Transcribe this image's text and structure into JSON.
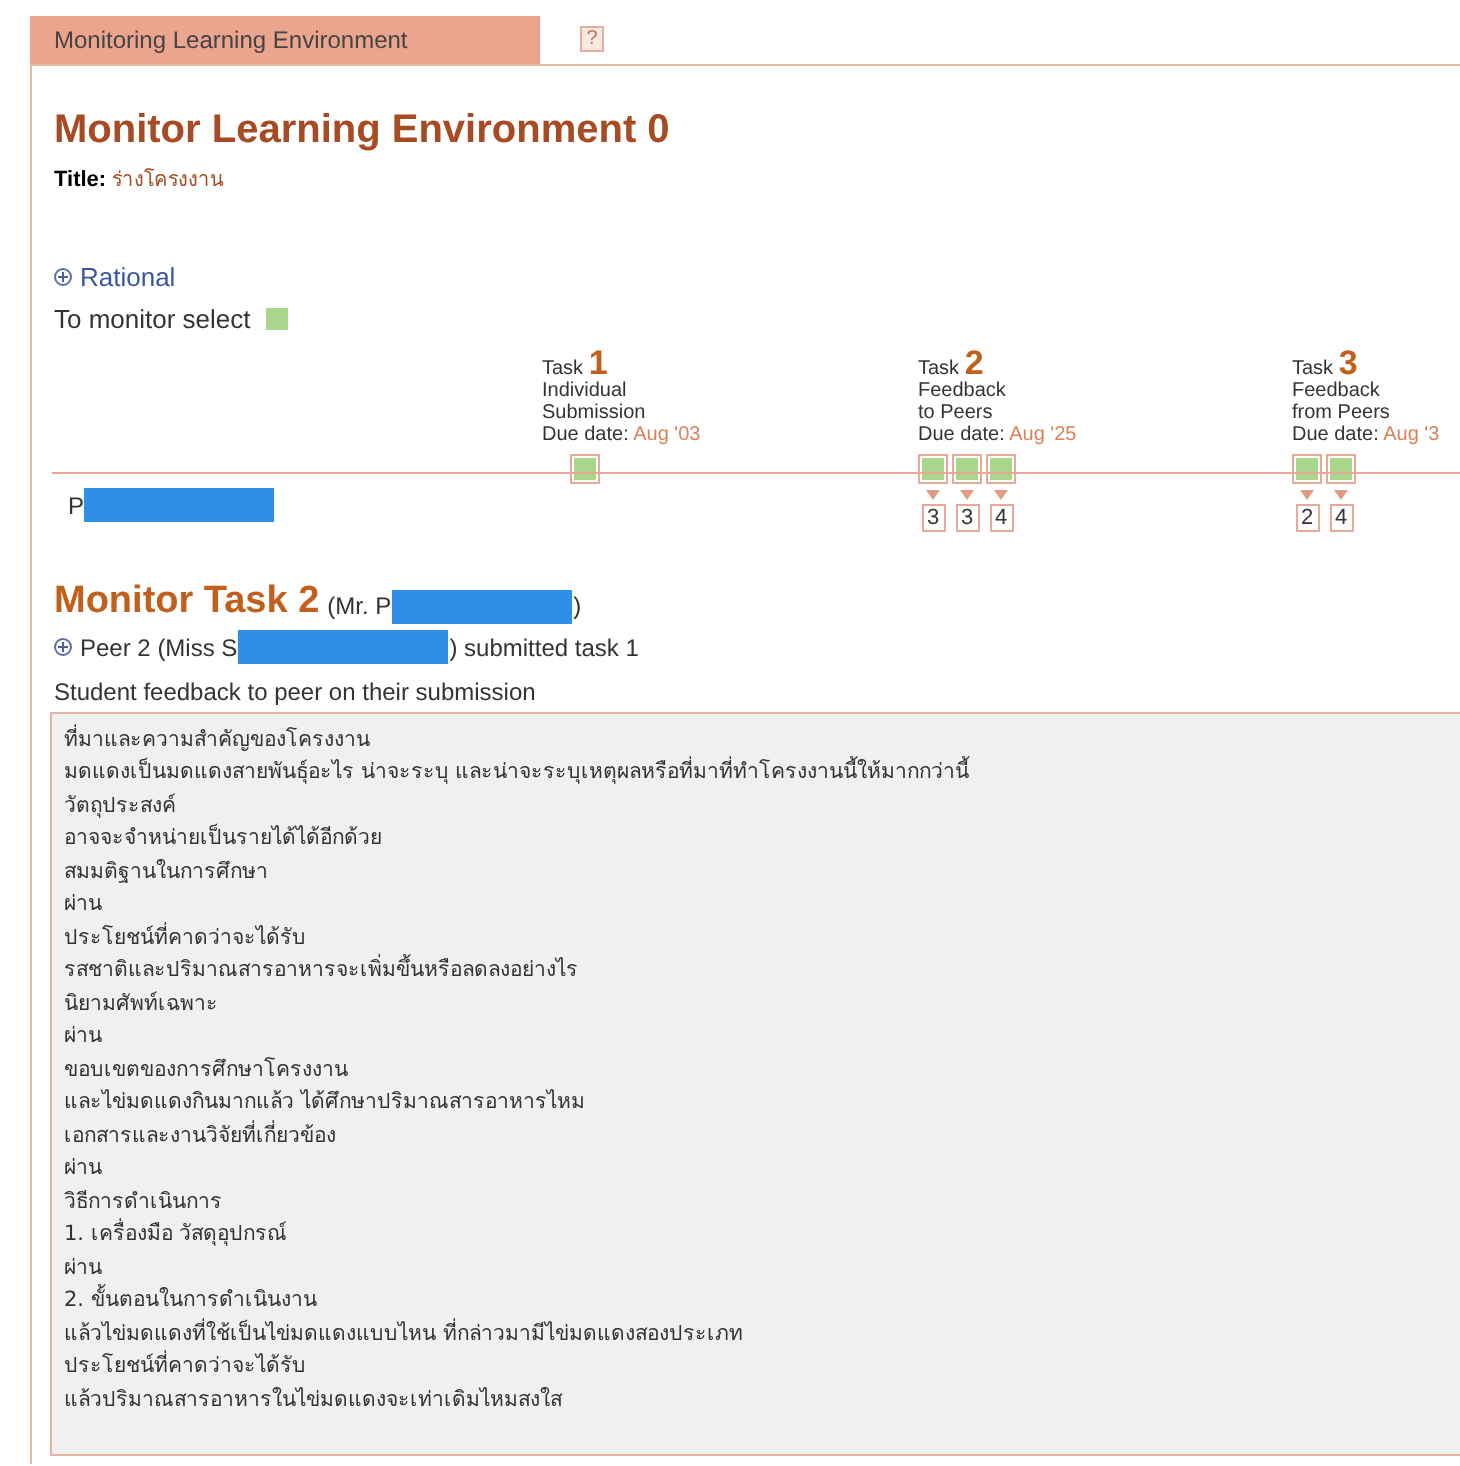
{
  "tab": {
    "label": "Monitoring Learning Environment",
    "selected": true
  },
  "help": {
    "label": "?"
  },
  "heading": "Monitor Learning Environment 0",
  "title": {
    "label": "Title:",
    "value": "ร่างโครงงาน"
  },
  "rational": {
    "label": "Rational",
    "expanded": false
  },
  "legend": {
    "label": "To monitor select"
  },
  "tasks": [
    {
      "word": "Task",
      "number": "1",
      "lines": [
        "Individual",
        "Submission"
      ],
      "due_label": "Due date:",
      "due": "Aug '03",
      "submissions": [
        {
          "kind": "pending"
        }
      ]
    },
    {
      "word": "Task",
      "number": "2",
      "lines": [
        "Feedback",
        "to Peers"
      ],
      "due_label": "Due date:",
      "due": "Aug '25",
      "submissions": [
        {
          "kind": "scored",
          "score": "3"
        },
        {
          "kind": "scored",
          "score": "3"
        },
        {
          "kind": "scored",
          "score": "4"
        }
      ]
    },
    {
      "word": "Task",
      "number": "3",
      "lines": [
        "Feedback",
        "from Peers"
      ],
      "due_label": "Due date:",
      "due": "Aug '3",
      "submissions": [
        {
          "kind": "scored",
          "score": "2"
        },
        {
          "kind": "scored",
          "score": "4"
        }
      ]
    }
  ],
  "student": {
    "name": "P",
    "redacted": true
  },
  "monitor": {
    "heading": "Monitor Task 2",
    "person_open": "(Mr. P",
    "person_close": ")",
    "redacted": true
  },
  "peer": {
    "expanded": false,
    "prefix": "Peer 2 (Miss S",
    "suffix": ") submitted task 1",
    "redacted": true
  },
  "feedback": {
    "label": "Student feedback to peer on their submission",
    "lines": [
      "ที่มาและความสำคัญของโครงงาน",
      "มดแดงเป็นมดแดงสายพันธุ์อะไร น่าจะระบุ และน่าจะระบุเหตุผลหรือที่มาที่ทำโครงงานนี้ให้มากกว่านี้",
      "วัตถุประสงค์",
      "อาจจะจำหน่ายเป็นรายได้ได้อีกด้วย",
      "สมมติฐานในการศึกษา",
      "ผ่าน",
      "ประโยชน์ที่คาดว่าจะได้รับ",
      "รสชาติและปริมาณสารอาหารจะเพิ่มขึ้นหรือลดลงอย่างไร",
      "นิยามศัพท์เฉพาะ",
      "ผ่าน",
      "ขอบเขตของการศึกษาโครงงาน",
      "และไข่มดแดงกินมากแล้ว ได้ศึกษาปริมาณสารอาหารไหม",
      "เอกสารและงานวิจัยที่เกี่ยวข้อง",
      "ผ่าน",
      "วิธีการดำเนินการ",
      "1. เครื่องมือ วัสดุอุปกรณ์",
      "ผ่าน",
      "2. ขั้นตอนในการดำเนินงาน",
      "แล้วไข่มดแดงที่ใช้เป็นไข่มดแดงแบบไหน ที่กล่าวมามีไข่มดแดงสองประเภท",
      "ประโยชน์ที่คาดว่าจะได้รับ",
      "แล้วปริมาณสารอาหารในไข่มดแดงจะเท่าเดิมไหมสงใส"
    ]
  }
}
